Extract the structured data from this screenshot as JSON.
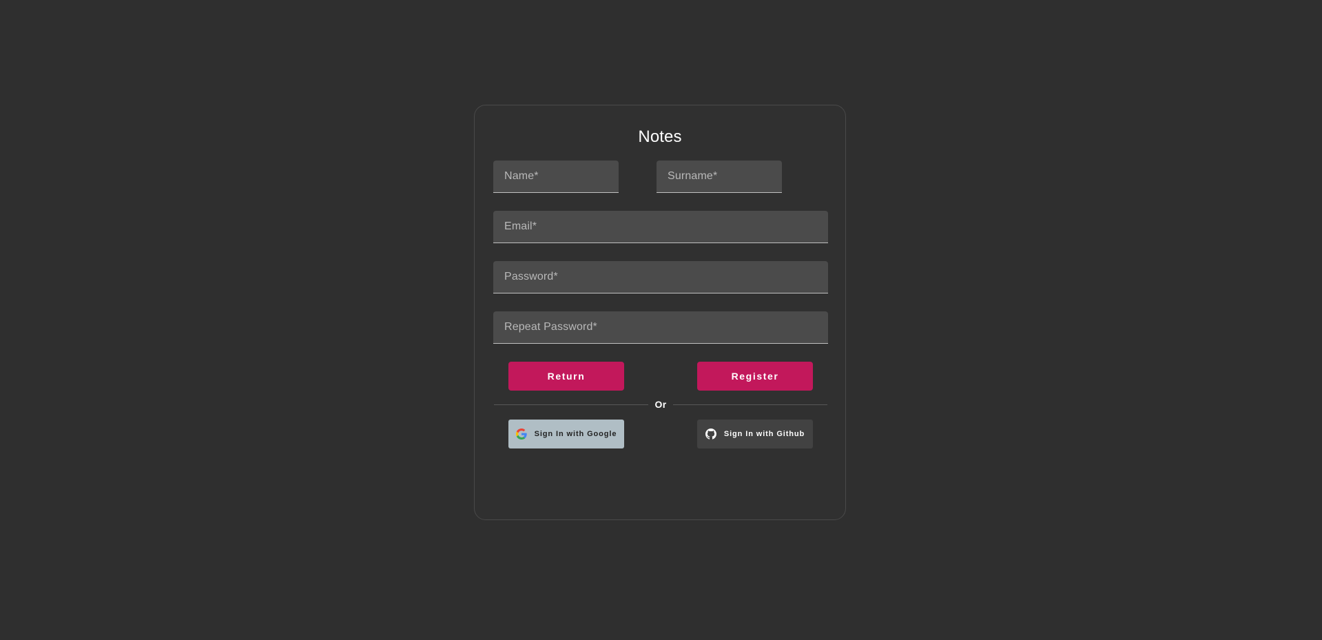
{
  "page": {
    "background_color": "#2f2f2f"
  },
  "card": {
    "title": "Notes",
    "background_color": "#303030",
    "border_color": "#4a4a4a"
  },
  "form": {
    "fields": [
      {
        "name": "name",
        "placeholder": "Name*",
        "value": "",
        "type": "text"
      },
      {
        "name": "surname",
        "placeholder": "Surname*",
        "value": "",
        "type": "text"
      },
      {
        "name": "email",
        "placeholder": "Email*",
        "value": "",
        "type": "email"
      },
      {
        "name": "password",
        "placeholder": "Password*",
        "value": "",
        "type": "password"
      },
      {
        "name": "repeat_password",
        "placeholder": "Repeat Password*",
        "value": "",
        "type": "password"
      }
    ]
  },
  "actions": {
    "return_label": "Return",
    "register_label": "Register",
    "accent_color": "#c2185b"
  },
  "divider": {
    "label": "Or"
  },
  "social": {
    "google": {
      "label": "Sign In with Google",
      "icon": "google-icon",
      "background_color": "#b0bec5",
      "text_color": "#212121"
    },
    "github": {
      "label": "Sign In with Github",
      "icon": "github-icon",
      "background_color": "#424242",
      "text_color": "#ffffff"
    }
  }
}
